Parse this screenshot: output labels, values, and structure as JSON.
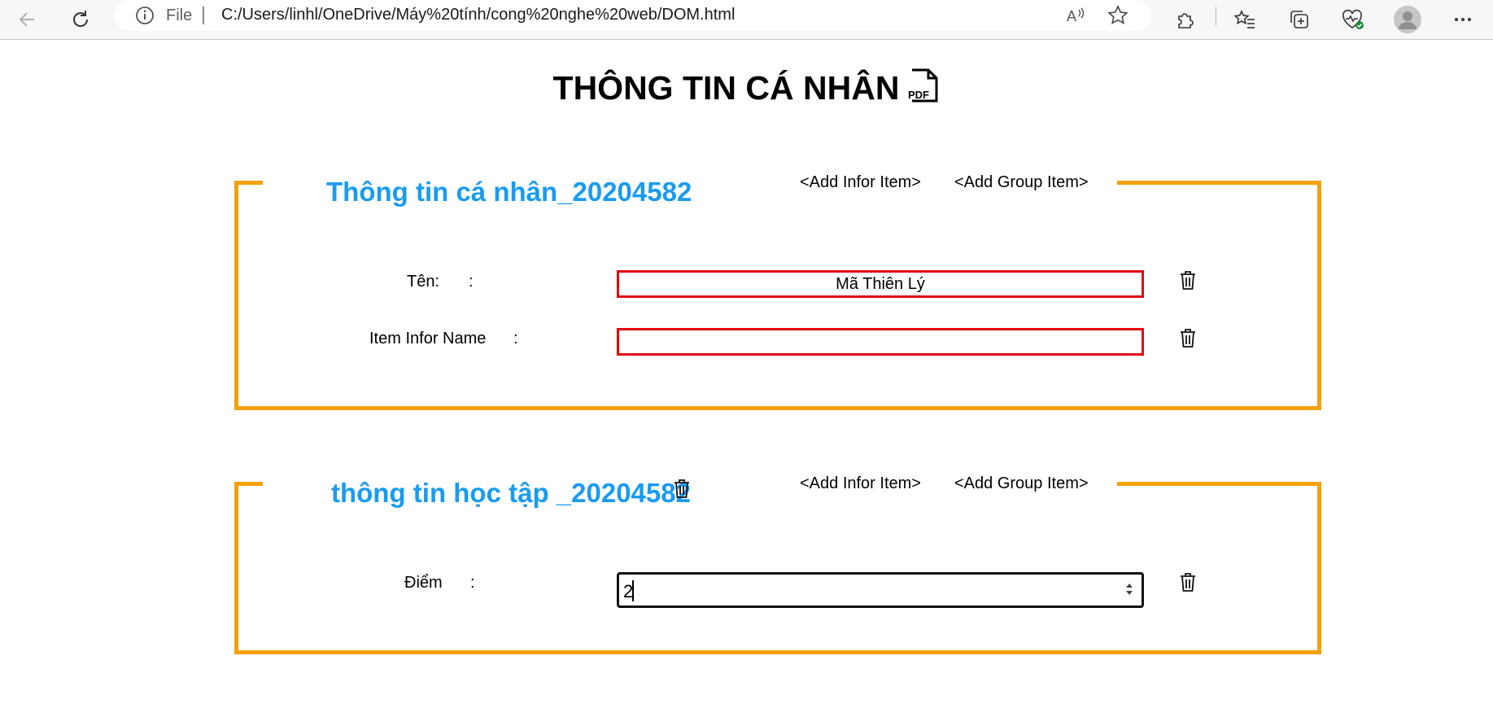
{
  "browser": {
    "file_label": "File",
    "url": "C:/Users/linhl/OneDrive/Máy%20tính/cong%20nghe%20web/DOM.html",
    "icons": [
      "back-icon",
      "refresh-icon",
      "info-icon",
      "read-aloud-icon",
      "favorite-star-icon",
      "extensions-icon",
      "favorites-icon",
      "collections-icon",
      "browser-essentials-icon",
      "profile-avatar",
      "more-menu-icon"
    ]
  },
  "page": {
    "title": "THÔNG TIN CÁ NHÂN",
    "pdf_icon_label": "PDF"
  },
  "accent_color": "#f4a10a",
  "group_title_color": "#1a9bef",
  "input_border_color": "#e30613",
  "groups": [
    {
      "title": "Thông tin cá nhân_20204582",
      "add_infor_label": "<Add Infor Item>",
      "add_group_label": "<Add Group Item>",
      "items": [
        {
          "label": "Tên:",
          "colon": ":",
          "value": "Mã Thiên Lý"
        },
        {
          "label": "Item Infor Name",
          "colon": ":",
          "value": ""
        }
      ]
    },
    {
      "title": "thông tin học tập _20204582",
      "add_infor_label": "<Add Infor Item>",
      "add_group_label": "<Add Group Item>",
      "items": [
        {
          "label": "Điểm",
          "colon": ":",
          "value": "2"
        }
      ]
    }
  ]
}
